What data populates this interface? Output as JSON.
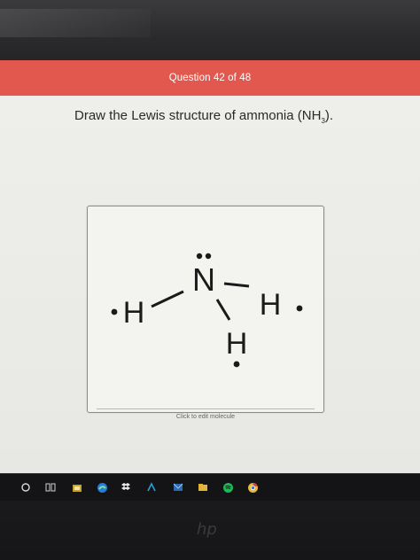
{
  "header": {
    "question_counter": "Question 42 of 48",
    "color": "#e2584e"
  },
  "question": {
    "prefix": "Draw the Lewis structure of ammonia (NH",
    "subscript": "3",
    "suffix": ")."
  },
  "molecule_editor": {
    "caption": "Click to edit molecule",
    "atoms": {
      "nitrogen": "N",
      "hydrogen_left": "H",
      "hydrogen_right": "H",
      "hydrogen_bottom": "H"
    }
  },
  "taskbar": {
    "icons": [
      "search-icon",
      "task-view-icon",
      "store-icon",
      "edge-icon",
      "dropbox-icon",
      "app-icon",
      "mail-icon",
      "file-explorer-icon",
      "spotify-icon",
      "chrome-icon"
    ]
  },
  "device": {
    "logo": "hp"
  }
}
